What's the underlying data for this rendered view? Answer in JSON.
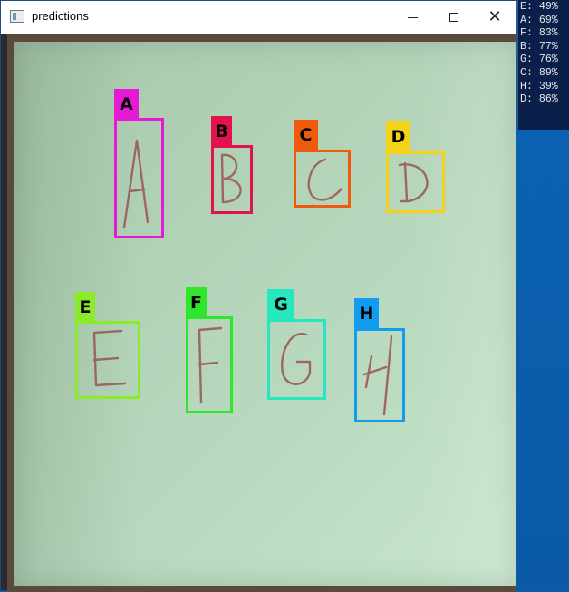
{
  "window": {
    "title": "predictions"
  },
  "icons": {
    "app": "app-window-icon",
    "minimize": "minimize-icon",
    "maximize": "maximize-icon",
    "close": "close-icon"
  },
  "detections": [
    {
      "label": "A",
      "color": "#e619d6"
    },
    {
      "label": "B",
      "color": "#e3124f"
    },
    {
      "label": "C",
      "color": "#f05a0c"
    },
    {
      "label": "D",
      "color": "#f4d21a"
    },
    {
      "label": "E",
      "color": "#8bea2a"
    },
    {
      "label": "F",
      "color": "#2fe62d"
    },
    {
      "label": "G",
      "color": "#27e6c0"
    },
    {
      "label": "H",
      "color": "#129cf0"
    }
  ],
  "console": {
    "lines": [
      "E: 49%",
      "A: 69%",
      "F: 83%",
      "B: 77%",
      "G: 76%",
      "C: 89%",
      "H: 39%",
      "D: 86%"
    ]
  }
}
